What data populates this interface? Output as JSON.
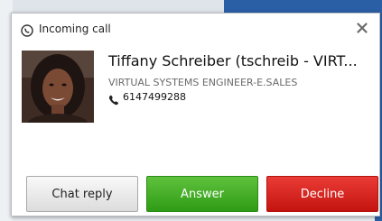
{
  "header": {
    "title": "Incoming call",
    "close_icon": "close-icon",
    "app_icon": "call-app-icon"
  },
  "caller": {
    "name": "Tiffany Schreiber (tschreib - VIRT...",
    "job_title": "VIRTUAL SYSTEMS ENGINEER-E.SALES",
    "phone": "6147499288",
    "phone_icon": "phone-icon"
  },
  "buttons": {
    "chat_reply": "Chat reply",
    "answer": "Answer",
    "decline": "Decline"
  },
  "colors": {
    "answer": "#3cab23",
    "decline": "#d9221d",
    "chat_reply": "#e8e8e8",
    "background_blue": "#2a5fa6"
  }
}
